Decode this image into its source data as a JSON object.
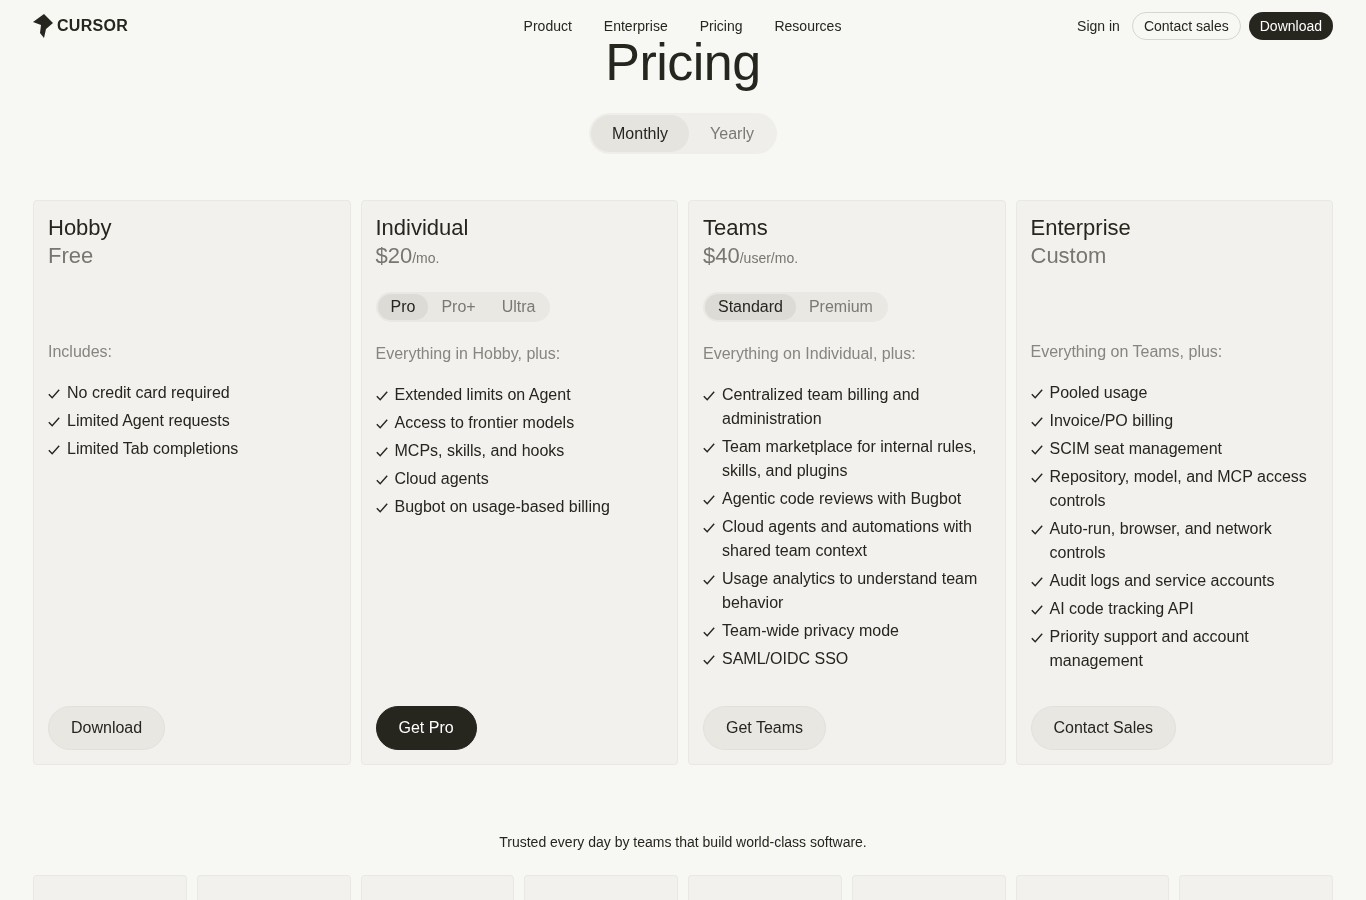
{
  "header": {
    "logo": {
      "text": "CURSOR"
    },
    "nav": [
      "Product",
      "Enterprise",
      "Pricing",
      "Resources"
    ],
    "actions": [
      {
        "label": "Sign in",
        "kind": "link"
      },
      {
        "label": "Contact sales",
        "kind": "outline"
      },
      {
        "label": "Download",
        "kind": "filled"
      }
    ]
  },
  "title": "Pricing",
  "billing_toggle": {
    "options": [
      {
        "label": "Monthly",
        "selected": true
      },
      {
        "label": "Yearly",
        "selected": false
      }
    ]
  },
  "plans": [
    {
      "name": "Hobby",
      "price": "Free",
      "features_heading": "Includes:",
      "features": [
        "No credit card required",
        "Limited Agent requests",
        "Limited Tab completions"
      ],
      "button": {
        "label": "Download",
        "primary": false
      }
    },
    {
      "name": "Individual",
      "price": "$20",
      "price_unit": "/mo.",
      "variants": [
        {
          "label": "Pro",
          "selected": true
        },
        {
          "label": "Pro+",
          "selected": false
        },
        {
          "label": "Ultra",
          "selected": false
        }
      ],
      "features_heading": "Everything in Hobby, plus:",
      "features": [
        "Extended limits on Agent",
        "Access to frontier models",
        "MCPs, skills, and hooks",
        "Cloud agents",
        "Bugbot on usage-based billing"
      ],
      "button": {
        "label": "Get Pro",
        "primary": true
      }
    },
    {
      "name": "Teams",
      "price": "$40",
      "price_unit": "/user/mo.",
      "variants": [
        {
          "label": "Standard",
          "selected": true
        },
        {
          "label": "Premium",
          "selected": false
        }
      ],
      "features_heading": "Everything on Individual, plus:",
      "features": [
        "Centralized team billing and administration",
        "Team marketplace for internal rules, skills, and plugins",
        "Agentic code reviews with Bugbot",
        "Cloud agents and automations with shared team context",
        "Usage analytics to understand team behavior",
        "Team-wide privacy mode",
        "SAML/OIDC SSO"
      ],
      "button": {
        "label": "Get Teams",
        "primary": false
      }
    },
    {
      "name": "Enterprise",
      "price": "Custom",
      "features_heading": "Everything on Teams, plus:",
      "features": [
        "Pooled usage",
        "Invoice/PO billing",
        "SCIM seat management",
        "Repository, model, and MCP access controls",
        "Auto-run, browser, and network controls",
        "Audit logs and service accounts",
        "AI code tracking API",
        "Priority support and account management"
      ],
      "button": {
        "label": "Contact Sales",
        "primary": false
      }
    }
  ],
  "trusted_caption": "Trusted every day by teams that build world-class software."
}
